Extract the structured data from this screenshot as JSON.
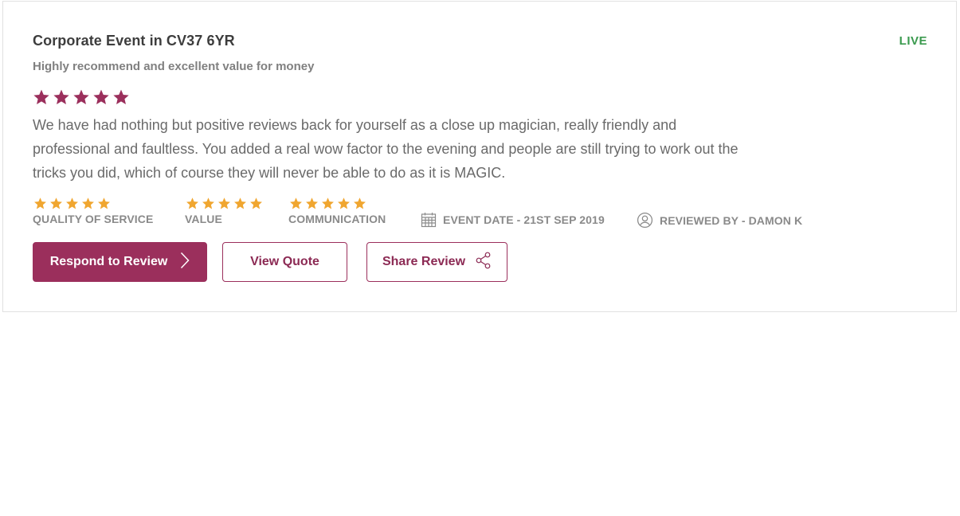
{
  "review": {
    "title": "Corporate Event in CV37 6YR",
    "status": "LIVE",
    "headline": "Highly recommend and excellent value for money",
    "overall_rating": 5,
    "body": "We have had nothing but positive reviews back for yourself as a close up magician, really friendly and professional and faultless. You added a real wow factor to the evening and people are still trying to work out the tricks you did, which of course they will never be able to do as it is MAGIC."
  },
  "ratings": [
    {
      "label": "QUALITY OF SERVICE",
      "stars": 5
    },
    {
      "label": "VALUE",
      "stars": 5
    },
    {
      "label": "COMMUNICATION",
      "stars": 5
    }
  ],
  "meta": {
    "event_date": "EVENT DATE - 21ST SEP 2019",
    "reviewed_by": "REVIEWED BY - DAMON K",
    "event_date_icon": "calendar-icon",
    "reviewed_by_icon": "user-circle-icon"
  },
  "actions": {
    "respond_label": "Respond to Review",
    "respond_icon": "chevron-right-icon",
    "quote_label": "View Quote",
    "share_label": "Share Review",
    "share_icon": "share-icon"
  },
  "colors": {
    "primary": "#9b2f5c",
    "overall_star": "#9b2f5c",
    "metric_star": "#f0a630",
    "live": "#3a9a4e"
  }
}
